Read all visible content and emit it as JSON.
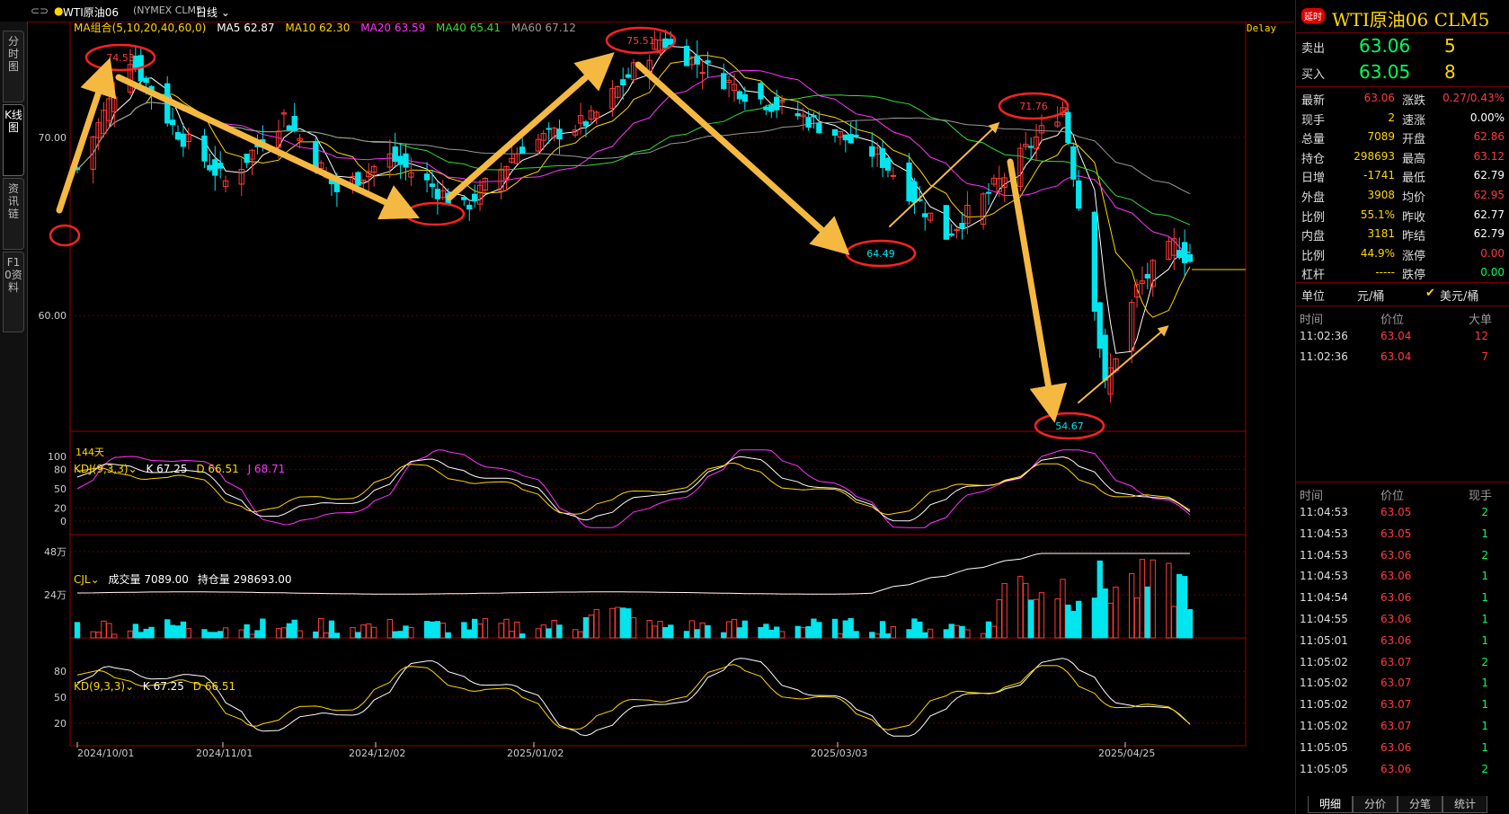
{
  "topbar": {
    "symbol": "WTI原油06",
    "exchange": "(NYMEX CLM5)",
    "period": "日线"
  },
  "left_tabs": [
    "分时图",
    "K线图",
    "资讯链",
    "F10资料"
  ],
  "main_legend": {
    "label": "MA组合(5,10,20,40,60,0)",
    "items": [
      {
        "text": "MA5 62.87",
        "color": "#ffffff"
      },
      {
        "text": "MA10 62.30",
        "color": "#ffd700"
      },
      {
        "text": "MA20 63.59",
        "color": "#ff33ff"
      },
      {
        "text": "MA40 65.41",
        "color": "#33dd33"
      },
      {
        "text": "MA60 67.12",
        "color": "#999999"
      }
    ],
    "delay": "Delay",
    "days": "144天"
  },
  "kdj_legend": {
    "label": "KDJ(9,3,3)",
    "k": "K 67.25",
    "d": "D 66.51",
    "j": "J 68.71"
  },
  "cjl_legend": {
    "label": "CJL",
    "vol": "成交量 7089.00",
    "oi": "持仓量 298693.00"
  },
  "kd_legend": {
    "label": "KD(9,3,3)",
    "k": "K 67.25",
    "d": "D 66.51"
  },
  "chart_data": {
    "type": "candlestick",
    "price_ticks": [
      "70.00",
      "60.00"
    ],
    "kdj_ticks": [
      "100",
      "80",
      "50",
      "20",
      "0"
    ],
    "vol_ticks": [
      "48万",
      "24万"
    ],
    "kd_ticks": [
      "80",
      "50",
      "20"
    ],
    "x_ticks": [
      "2024/10/01",
      "2024/11/01",
      "2024/12/02",
      "2025/01/02",
      "2025/03/03",
      "2025/04/25"
    ],
    "annotations": [
      "74.53",
      "75.51",
      "64.49",
      "71.76",
      "54.67"
    ],
    "price_range": [
      53.5,
      76.5
    ],
    "approx_close_path": [
      {
        "date": "2024/09/27",
        "close": 68.2
      },
      {
        "date": "2024/10/07",
        "close": 74.5
      },
      {
        "date": "2024/10/15",
        "close": 70.6
      },
      {
        "date": "2024/10/25",
        "close": 67.5
      },
      {
        "date": "2024/11/05",
        "close": 71.2
      },
      {
        "date": "2024/11/15",
        "close": 67.0
      },
      {
        "date": "2024/11/25",
        "close": 68.9
      },
      {
        "date": "2024/12/09",
        "close": 66.0
      },
      {
        "date": "2024/12/20",
        "close": 69.5
      },
      {
        "date": "2025/01/02",
        "close": 71.0
      },
      {
        "date": "2025/01/15",
        "close": 75.5
      },
      {
        "date": "2025/01/31",
        "close": 72.5
      },
      {
        "date": "2025/02/12",
        "close": 71.0
      },
      {
        "date": "2025/02/25",
        "close": 69.0
      },
      {
        "date": "2025/03/05",
        "close": 66.3
      },
      {
        "date": "2025/03/10",
        "close": 64.5
      },
      {
        "date": "2025/03/20",
        "close": 67.5
      },
      {
        "date": "2025/04/01",
        "close": 71.7
      },
      {
        "date": "2025/04/07",
        "close": 60.7
      },
      {
        "date": "2025/04/09",
        "close": 56.0
      },
      {
        "date": "2025/04/15",
        "close": 61.5
      },
      {
        "date": "2025/04/22",
        "close": 64.0
      },
      {
        "date": "2025/04/25",
        "close": 63.06
      }
    ]
  },
  "quote": {
    "title": "WTI原油06 CLM5",
    "badge": "延时",
    "sell_label": "卖出",
    "sell_price": "63.06",
    "sell_qty": "5",
    "buy_label": "买入",
    "buy_price": "63.05",
    "buy_qty": "8",
    "rows": [
      {
        "l1": "最新",
        "v1": "63.06",
        "c1": "red",
        "l2": "涨跌",
        "v2": "0.27/0.43%",
        "c2": "red"
      },
      {
        "l1": "现手",
        "v1": "2",
        "c1": "yel",
        "l2": "速涨",
        "v2": "0.00%",
        "c2": "wht"
      },
      {
        "l1": "总量",
        "v1": "7089",
        "c1": "yel",
        "l2": "开盘",
        "v2": "62.86",
        "c2": "red"
      },
      {
        "l1": "持仓",
        "v1": "298693",
        "c1": "yel",
        "l2": "最高",
        "v2": "63.12",
        "c2": "red"
      },
      {
        "l1": "日增",
        "v1": "-1741",
        "c1": "yel",
        "l2": "最低",
        "v2": "62.79",
        "c2": "wht"
      },
      {
        "l1": "外盘",
        "v1": "3908",
        "c1": "yel",
        "l2": "均价",
        "v2": "62.95",
        "c2": "red"
      },
      {
        "l1": "比例",
        "v1": "55.1%",
        "c1": "yel",
        "l2": "昨收",
        "v2": "62.77",
        "c2": "wht"
      },
      {
        "l1": "内盘",
        "v1": "3181",
        "c1": "yel",
        "l2": "昨结",
        "v2": "62.79",
        "c2": "wht"
      },
      {
        "l1": "比例",
        "v1": "44.9%",
        "c1": "yel",
        "l2": "涨停",
        "v2": "0.00",
        "c2": "red"
      },
      {
        "l1": "杠杆",
        "v1": "-----",
        "c1": "yel",
        "l2": "跌停",
        "v2": "0.00",
        "c2": "grn"
      }
    ],
    "unit_label": "单位",
    "unit_value": "元/桶",
    "unit_check": "美元/桶",
    "big_header": [
      "时间",
      "价位",
      "大单"
    ],
    "big_rows": [
      {
        "time": "11:02:36",
        "price": "63.04",
        "qty": "12"
      },
      {
        "time": "11:02:36",
        "price": "63.04",
        "qty": "7"
      }
    ],
    "tick_header": [
      "时间",
      "价位",
      "现手"
    ],
    "tick_rows": [
      {
        "time": "11:04:53",
        "price": "63.05",
        "qty": "2"
      },
      {
        "time": "11:04:53",
        "price": "63.05",
        "qty": "1"
      },
      {
        "time": "11:04:53",
        "price": "63.06",
        "qty": "2"
      },
      {
        "time": "11:04:53",
        "price": "63.06",
        "qty": "1"
      },
      {
        "time": "11:04:54",
        "price": "63.06",
        "qty": "1"
      },
      {
        "time": "11:04:55",
        "price": "63.06",
        "qty": "1"
      },
      {
        "time": "11:05:01",
        "price": "63.06",
        "qty": "1"
      },
      {
        "time": "11:05:02",
        "price": "63.07",
        "qty": "2"
      },
      {
        "time": "11:05:02",
        "price": "63.07",
        "qty": "1"
      },
      {
        "time": "11:05:02",
        "price": "63.07",
        "qty": "1"
      },
      {
        "time": "11:05:02",
        "price": "63.07",
        "qty": "1"
      },
      {
        "time": "11:05:05",
        "price": "63.06",
        "qty": "1"
      },
      {
        "time": "11:05:05",
        "price": "63.06",
        "qty": "2"
      }
    ],
    "bottom_tabs": [
      "明细",
      "分价",
      "分笔",
      "统计"
    ]
  },
  "colors": {
    "up": "#ff3b3b",
    "down": "#00e5ee",
    "grid": "#600000",
    "arrow": "#f5b942",
    "circle": "#ff2222"
  }
}
